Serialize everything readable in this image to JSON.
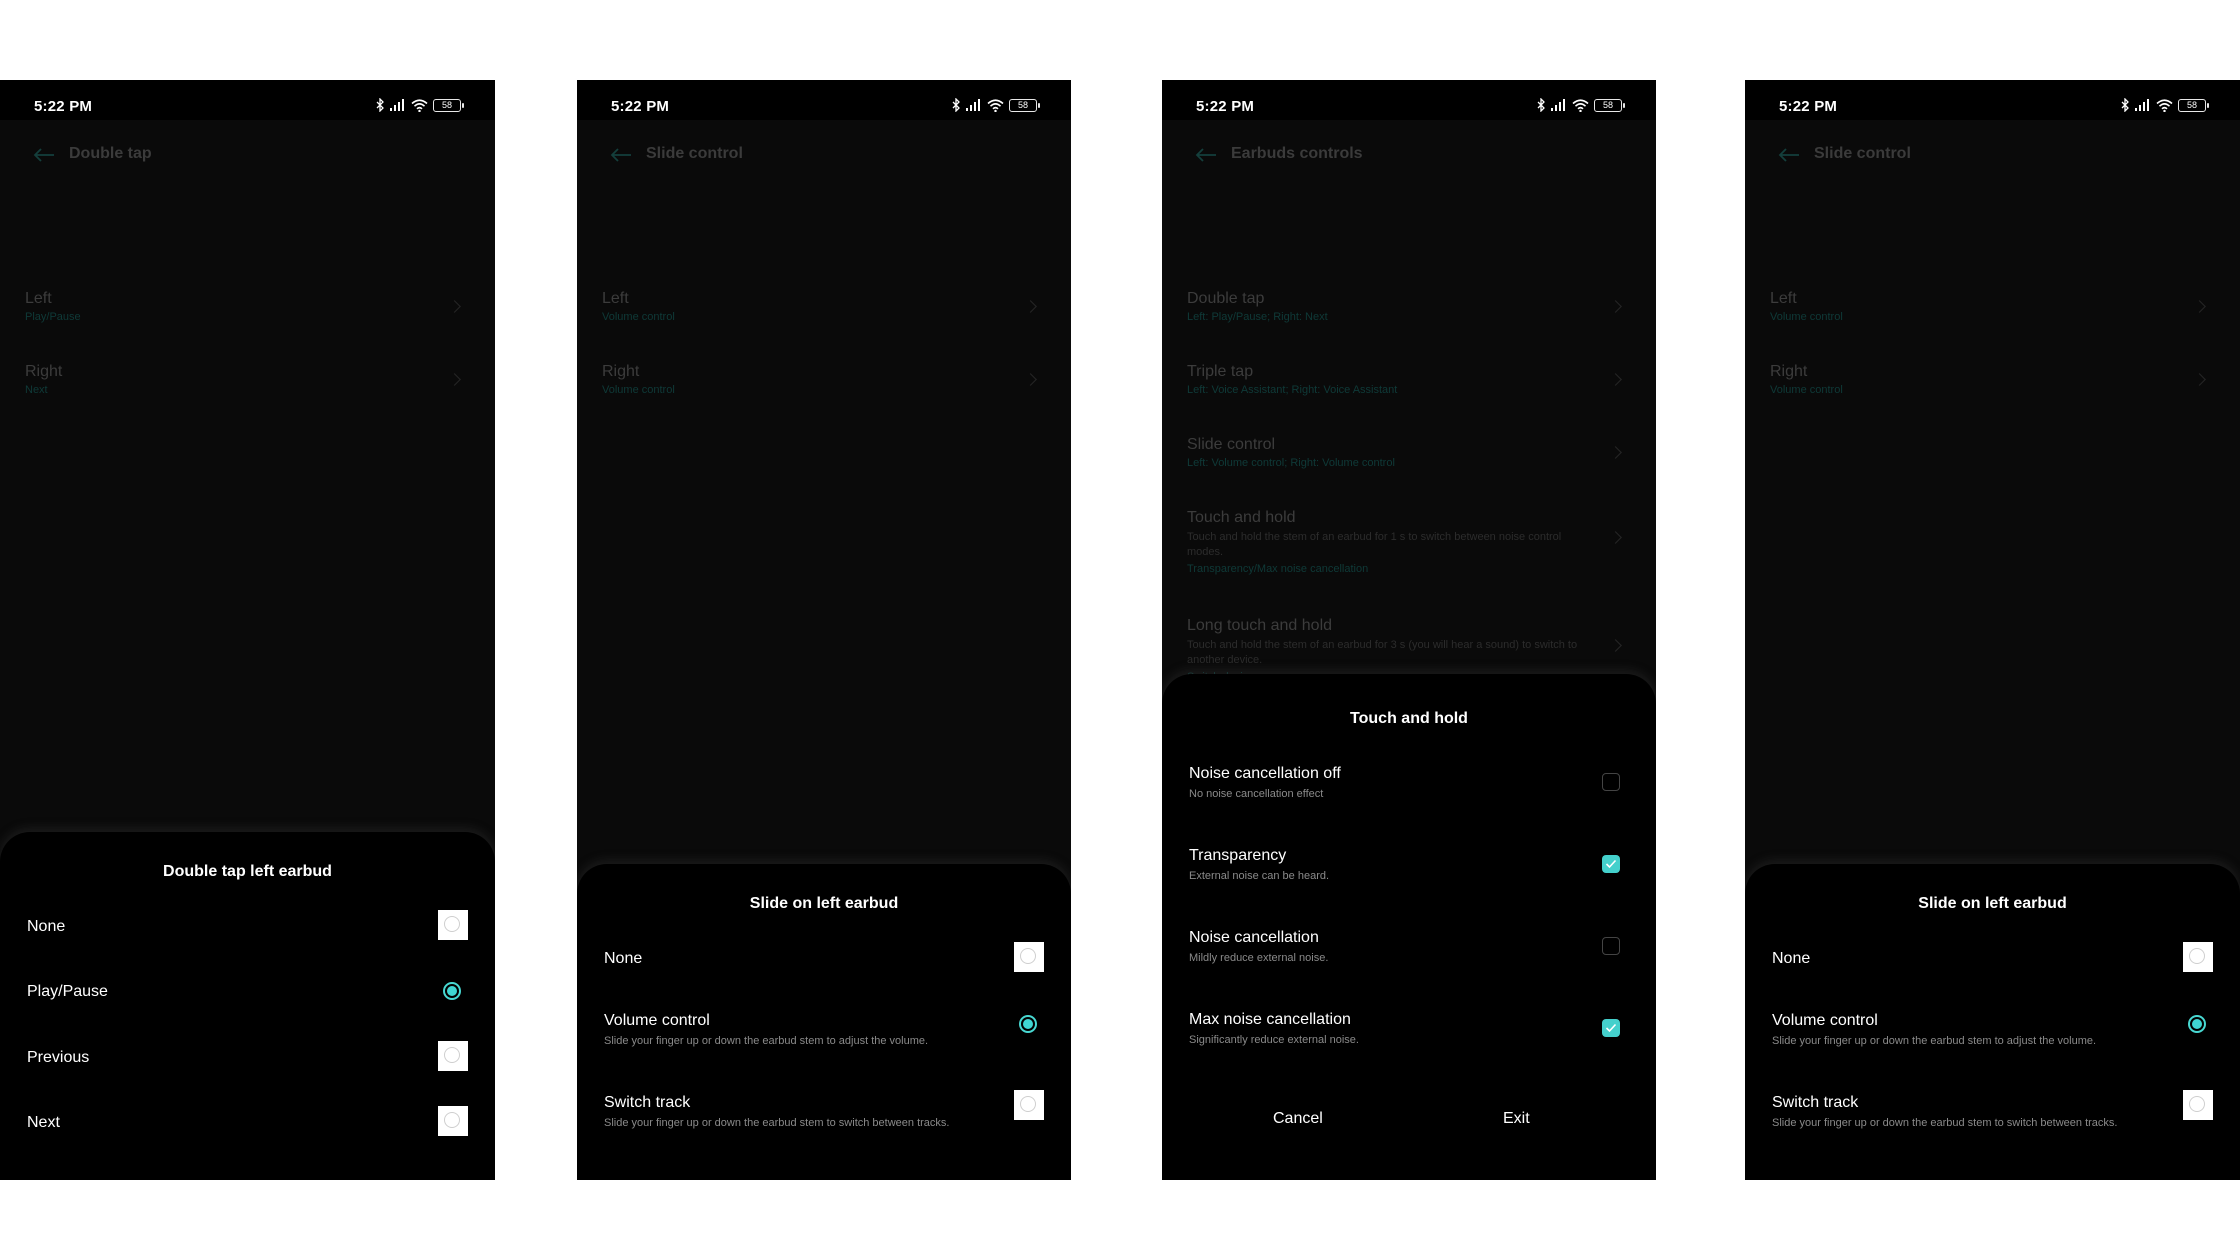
{
  "status_bar": {
    "time": "5:22 PM",
    "battery": "58"
  },
  "colors": {
    "accent": "#3fd6d2",
    "sheet_bg": "#000000",
    "screen_bg": "#0a0a0a"
  },
  "phones": [
    {
      "page_title": "Double tap",
      "background_items": [
        {
          "title": "Left",
          "value": "Play/Pause"
        },
        {
          "title": "Right",
          "value": "Next"
        }
      ],
      "sheet": {
        "title": "Double tap left earbud",
        "control": "radio",
        "options": [
          {
            "label": "None",
            "selected": false
          },
          {
            "label": "Play/Pause",
            "selected": true
          },
          {
            "label": "Previous",
            "selected": false
          },
          {
            "label": "Next",
            "selected": false
          }
        ]
      }
    },
    {
      "page_title": "Slide control",
      "background_items": [
        {
          "title": "Left",
          "value": "Volume control"
        },
        {
          "title": "Right",
          "value": "Volume control"
        }
      ],
      "sheet": {
        "title": "Slide on left earbud",
        "control": "radio",
        "options": [
          {
            "label": "None",
            "selected": false
          },
          {
            "label": "Volume control",
            "desc": "Slide your finger up or down the earbud stem to adjust the volume.",
            "selected": true
          },
          {
            "label": "Switch track",
            "desc": "Slide your finger up or down the earbud stem to switch between tracks.",
            "selected": false
          }
        ]
      }
    },
    {
      "page_title": "Earbuds controls",
      "background_items": [
        {
          "title": "Double tap",
          "value": "Left: Play/Pause; Right: Next"
        },
        {
          "title": "Triple tap",
          "value": "Left: Voice Assistant; Right: Voice Assistant"
        },
        {
          "title": "Slide control",
          "value": "Left: Volume control; Right: Volume control"
        },
        {
          "title": "Touch and hold",
          "desc": "Touch and hold the stem of an earbud for 1 s to switch between noise control modes.",
          "value": "Transparency/Max noise cancellation"
        },
        {
          "title": "Long touch and hold",
          "desc": "Touch and hold the stem of an earbud for 3 s (you will hear a sound) to switch to another device.",
          "value": "Switch devices"
        }
      ],
      "sheet": {
        "title": "Touch and hold",
        "control": "checkbox",
        "options": [
          {
            "label": "Noise cancellation off",
            "desc": "No noise cancellation effect",
            "selected": false
          },
          {
            "label": "Transparency",
            "desc": "External noise can be heard.",
            "selected": true
          },
          {
            "label": "Noise cancellation",
            "desc": "Mildly reduce external noise.",
            "selected": false
          },
          {
            "label": "Max noise cancellation",
            "desc": "Significantly reduce external noise.",
            "selected": true
          }
        ],
        "cancel_label": "Cancel",
        "exit_label": "Exit"
      }
    },
    {
      "page_title": "Slide control",
      "background_items": [
        {
          "title": "Left",
          "value": "Volume control"
        },
        {
          "title": "Right",
          "value": "Volume control"
        }
      ],
      "sheet": {
        "title": "Slide on left earbud",
        "control": "radio",
        "options": [
          {
            "label": "None",
            "selected": false
          },
          {
            "label": "Volume control",
            "desc": "Slide your finger up or down the earbud stem to adjust the volume.",
            "selected": true
          },
          {
            "label": "Switch track",
            "desc": "Slide your finger up or down the earbud stem to switch between tracks.",
            "selected": false
          }
        ]
      }
    }
  ]
}
